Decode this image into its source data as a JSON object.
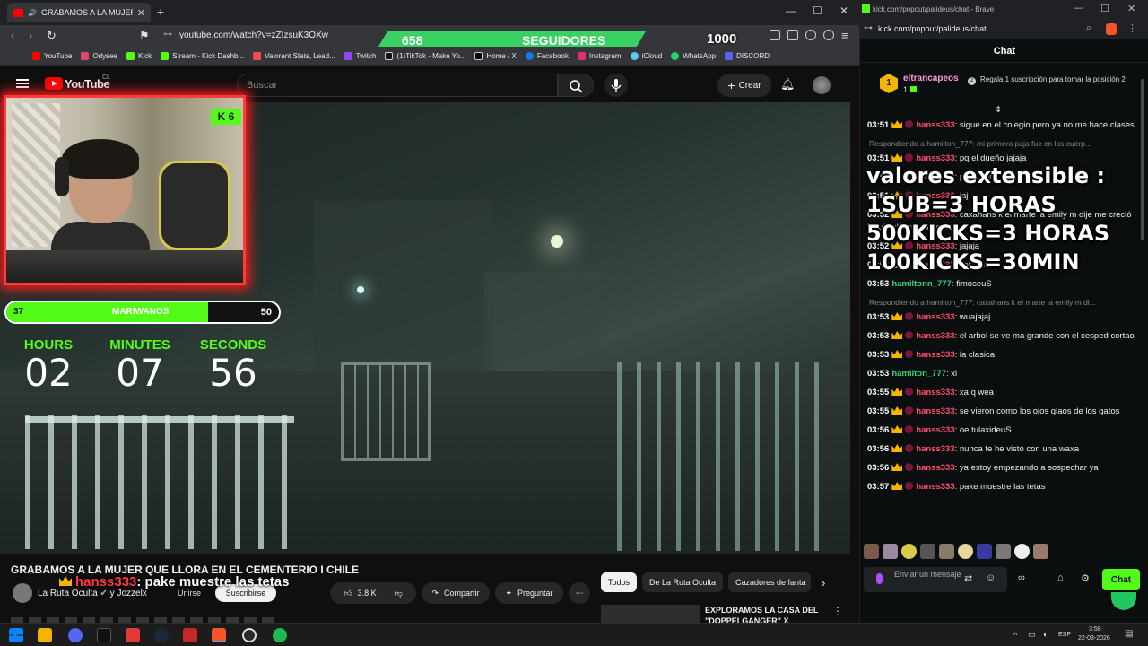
{
  "browser": {
    "tab_title": "GRABAMOS A LA MUJER QU",
    "url": "youtube.com/watch?v=zZIzsuK3OXw",
    "bookmarks": [
      "YouTube",
      "Odysee",
      "Kick",
      "Stream - Kick Dashb...",
      "Valorant Stats, Lead...",
      "Twitch",
      "(1)TikTok - Make Yo...",
      "Home / X",
      "Facebook",
      "Instagram",
      "iCloud",
      "WhatsApp",
      "DISCORD"
    ]
  },
  "stream_overlay": {
    "followers_count": "658",
    "followers_label": "SEGUIDORES",
    "followers_goal": "1000",
    "kick_badge": "6",
    "progress": {
      "current": "37",
      "label": "MARIWANOS",
      "max": "50",
      "fraction": 0.74
    },
    "timer": {
      "hours_label": "HOURS",
      "hours": "02",
      "minutes_label": "MINUTES",
      "minutes": "07",
      "seconds_label": "SECONDS",
      "seconds": "56"
    },
    "tts_user": "hanss333",
    "tts_text": ": pake muestre las tetas",
    "extension_lines": [
      "valores extensible :",
      "1SUB=3 HORAS",
      "500KICKS=3 HORAS",
      "100KICKS=30MIN"
    ]
  },
  "youtube": {
    "logo_text": "YouTube",
    "country": "CL",
    "search_placeholder": "Buscar",
    "create_label": "Crear",
    "video_title": "GRABAMOS A LA MUJER QUE LLORA EN EL CEMENTERIO I CHILE",
    "channel": "La Ruta Oculta",
    "channel_suffix": "y Jozzelx",
    "join_label": "Unirse",
    "subscribe_label": "Suscribirse",
    "likes": "3.8 K",
    "share_label": "Compartir",
    "ask_label": "Preguntar",
    "chips": [
      "Todos",
      "De La Ruta Oculta",
      "Cazadores de fanta"
    ],
    "reco_title": "EXPLORAMOS LA CASA DEL \"DOPPELGANGER\" X"
  },
  "kick": {
    "window_title": "kick.com/popout/palideus/chat - Brave",
    "url": "kick.com/popout/palideus/chat",
    "header": "Chat",
    "pinned_rank": "1",
    "pinned_user": "eltrancapeos",
    "pinned_count": "1",
    "pinned_text": "Regala 1 suscripción para tomar la posición 2",
    "messages": [
      {
        "ts": "03:51",
        "user": "hanss333",
        "color": "red",
        "badge": true,
        "text": ": sigue en el colegio pero ya no me hace clases"
      },
      {
        "reply": "Respondiendo a hamilton_777: mi primera paja fue cn los cuerp..."
      },
      {
        "ts": "03:51",
        "user": "hanss333",
        "color": "red",
        "badge": true,
        "text": ": pq el dueño jajaja"
      },
      {
        "ts": "03:51",
        "user": "hanss333",
        "color": "red",
        "badge": true,
        "text": ": poco serio jajaja"
      },
      {
        "ts": "03:51",
        "user": "hanss333",
        "color": "red",
        "badge": true,
        "text": ": jaj"
      },
      {
        "ts": "03:52",
        "user": "hanss333",
        "color": "red",
        "badge": true,
        "text": ": caxahans k el marte la emily m dije me creció la tula xke me la depile"
      },
      {
        "ts": "03:52",
        "user": "hanss333",
        "color": "red",
        "badge": true,
        "text": ": jajaja"
      },
      {
        "ts": "03:53",
        "user": "hanss333",
        "color": "red",
        "badge": true,
        "text": ": ketadeuS"
      },
      {
        "ts": "03:53",
        "user": "hamiltonn_777",
        "color": "green",
        "badge": false,
        "text": ": fimoseuS"
      },
      {
        "reply": "Respondiendo a hamilton_777: caxahans k el marte la emily m di..."
      },
      {
        "ts": "03:53",
        "user": "hanss333",
        "color": "red",
        "badge": true,
        "text": ": wuajajaj"
      },
      {
        "ts": "03:53",
        "user": "hanss333",
        "color": "red",
        "badge": true,
        "text": ": el arbol se ve ma grande con el cesped cortao"
      },
      {
        "ts": "03:53",
        "user": "hanss333",
        "color": "red",
        "badge": true,
        "text": ": la clasica"
      },
      {
        "ts": "03:53",
        "user": "hamilton_777",
        "color": "green",
        "badge": false,
        "text": ": xi"
      },
      {
        "ts": "03:55",
        "user": "hanss333",
        "color": "red",
        "badge": true,
        "text": ": xa q wea"
      },
      {
        "ts": "03:55",
        "user": "hanss333",
        "color": "red",
        "badge": true,
        "text": ": se vieron como los ojos qlaos de los gatos"
      },
      {
        "ts": "03:56",
        "user": "hanss333",
        "color": "red",
        "badge": true,
        "text": ": oe tulaxideuS"
      },
      {
        "ts": "03:56",
        "user": "hanss333",
        "color": "red",
        "badge": true,
        "text": ": nunca te he visto con una waxa"
      },
      {
        "ts": "03:56",
        "user": "hanss333",
        "color": "red",
        "badge": true,
        "text": ": ya estoy empezando a sospechar ya"
      },
      {
        "ts": "03:57",
        "user": "hanss333",
        "color": "red",
        "badge": true,
        "text": ": pake muestre las tetas"
      }
    ],
    "input_placeholder": "Enviar un mensaje",
    "chat_button": "Chat"
  },
  "taskbar": {
    "lang": "ESP",
    "time": "3:58",
    "date": "22-03-2026"
  },
  "colors": {
    "kick_green": "#53fc18",
    "yt_red": "#ff0000",
    "cam_border": "#ff3b3b"
  }
}
